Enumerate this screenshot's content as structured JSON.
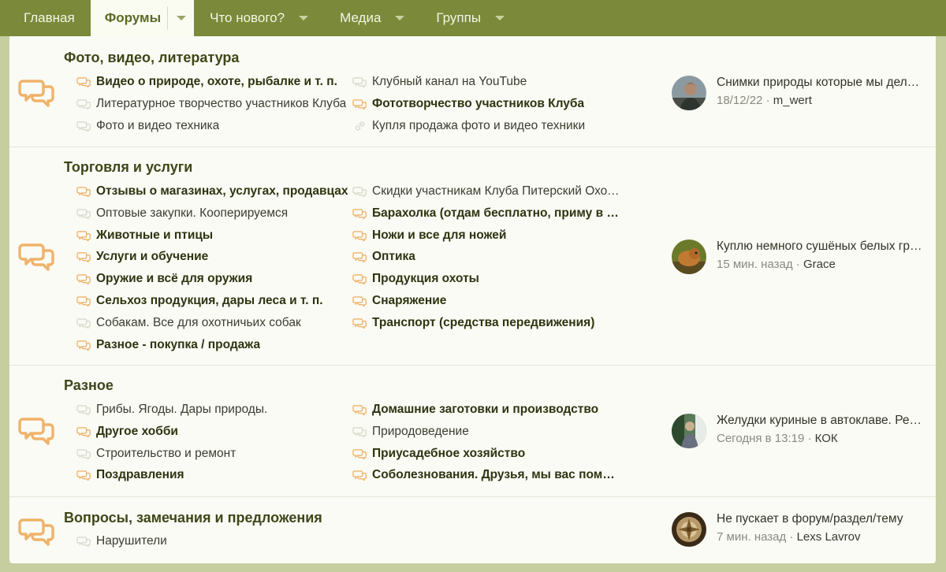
{
  "nav": {
    "home": "Главная",
    "forums": "Форумы",
    "whats_new": "Что нового?",
    "media": "Медиа",
    "groups": "Группы"
  },
  "nodes": [
    {
      "title": "Фото, видео, литература",
      "col1": [
        {
          "label": "Видео о природе, охоте, рыбалке и т. п.",
          "unread": true,
          "icon": "chat-icon"
        },
        {
          "label": "Литературное творчество участников Клуба",
          "unread": false,
          "icon": "chat-icon"
        },
        {
          "label": "Фото и видео техника",
          "unread": false,
          "icon": "chat-icon"
        }
      ],
      "col2": [
        {
          "label": "Клубный канал на YouTube",
          "unread": false,
          "icon": "chat-icon"
        },
        {
          "label": "Фототворчество участников Клуба",
          "unread": true,
          "icon": "chat-icon"
        },
        {
          "label": "Купля продажа фото и видео техники",
          "unread": false,
          "icon": "link-icon"
        }
      ],
      "latest": {
        "title": "Снимки природы которые мы делаем",
        "date": "18/12/22",
        "user": "m_wert"
      }
    },
    {
      "title": "Торговля и услуги",
      "col1": [
        {
          "label": "Отзывы о магазинах, услугах, продавцах",
          "unread": true,
          "icon": "chat-icon"
        },
        {
          "label": "Оптовые закупки. Кооперируемся",
          "unread": false,
          "icon": "chat-icon"
        },
        {
          "label": "Животные и птицы",
          "unread": true,
          "icon": "chat-icon"
        },
        {
          "label": "Услуги и обучение",
          "unread": true,
          "icon": "chat-icon"
        },
        {
          "label": "Оружие и всё для оружия",
          "unread": true,
          "icon": "chat-icon"
        },
        {
          "label": "Сельхоз продукция, дары леса и т. п.",
          "unread": true,
          "icon": "chat-icon"
        },
        {
          "label": "Собакам. Все для охотничьих собак",
          "unread": false,
          "icon": "chat-icon"
        },
        {
          "label": "Разное - покупка / продажа",
          "unread": true,
          "icon": "chat-icon"
        }
      ],
      "col2": [
        {
          "label": "Скидки участникам Клуба Питерский Охотник",
          "unread": false,
          "icon": "chat-icon"
        },
        {
          "label": "Барахолка (отдам бесплатно, приму в дар)",
          "unread": true,
          "icon": "chat-icon"
        },
        {
          "label": "Ножи и все для ножей",
          "unread": true,
          "icon": "chat-icon"
        },
        {
          "label": "Оптика",
          "unread": true,
          "icon": "chat-icon"
        },
        {
          "label": "Продукция охоты",
          "unread": true,
          "icon": "chat-icon"
        },
        {
          "label": "Снаряжение",
          "unread": true,
          "icon": "chat-icon"
        },
        {
          "label": "Транспорт (средства передвижения)",
          "unread": true,
          "icon": "chat-icon"
        }
      ],
      "latest": {
        "title": "Куплю немного сушёных белых грибов",
        "date": "15 мин. назад",
        "user": "Grace"
      }
    },
    {
      "title": "Разное",
      "col1": [
        {
          "label": "Грибы. Ягоды. Дары природы.",
          "unread": false,
          "icon": "chat-icon"
        },
        {
          "label": "Другое хобби",
          "unread": true,
          "icon": "chat-icon"
        },
        {
          "label": "Строительство и ремонт",
          "unread": false,
          "icon": "chat-icon"
        },
        {
          "label": "Поздравления",
          "unread": true,
          "icon": "chat-icon"
        }
      ],
      "col2": [
        {
          "label": "Домашние заготовки и производство",
          "unread": true,
          "icon": "chat-icon"
        },
        {
          "label": "Природоведение",
          "unread": false,
          "icon": "chat-icon"
        },
        {
          "label": "Приусадебное хозяйство",
          "unread": true,
          "icon": "chat-icon"
        },
        {
          "label": "Соболезнования. Друзья, мы вас помним",
          "unread": true,
          "icon": "chat-icon"
        }
      ],
      "latest": {
        "title": "Желудки куриные в автоклаве. Рецепт",
        "date": "Сегодня в 13:19",
        "user": "КОК"
      }
    },
    {
      "title": "Вопросы, замечания и предложения",
      "col1": [
        {
          "label": "Нарушители",
          "unread": false,
          "icon": "chat-icon"
        }
      ],
      "col2": [],
      "latest": {
        "title": "Не пускает в форум/раздел/тему",
        "date": "7 мин. назад",
        "user": "Lexs Lavrov"
      }
    }
  ],
  "colors": {
    "nav_bg": "#7a8a3a",
    "accent_orange": "#f0b26a",
    "read_icon": "#d8dacb",
    "page_bg": "#c6ce9f"
  }
}
